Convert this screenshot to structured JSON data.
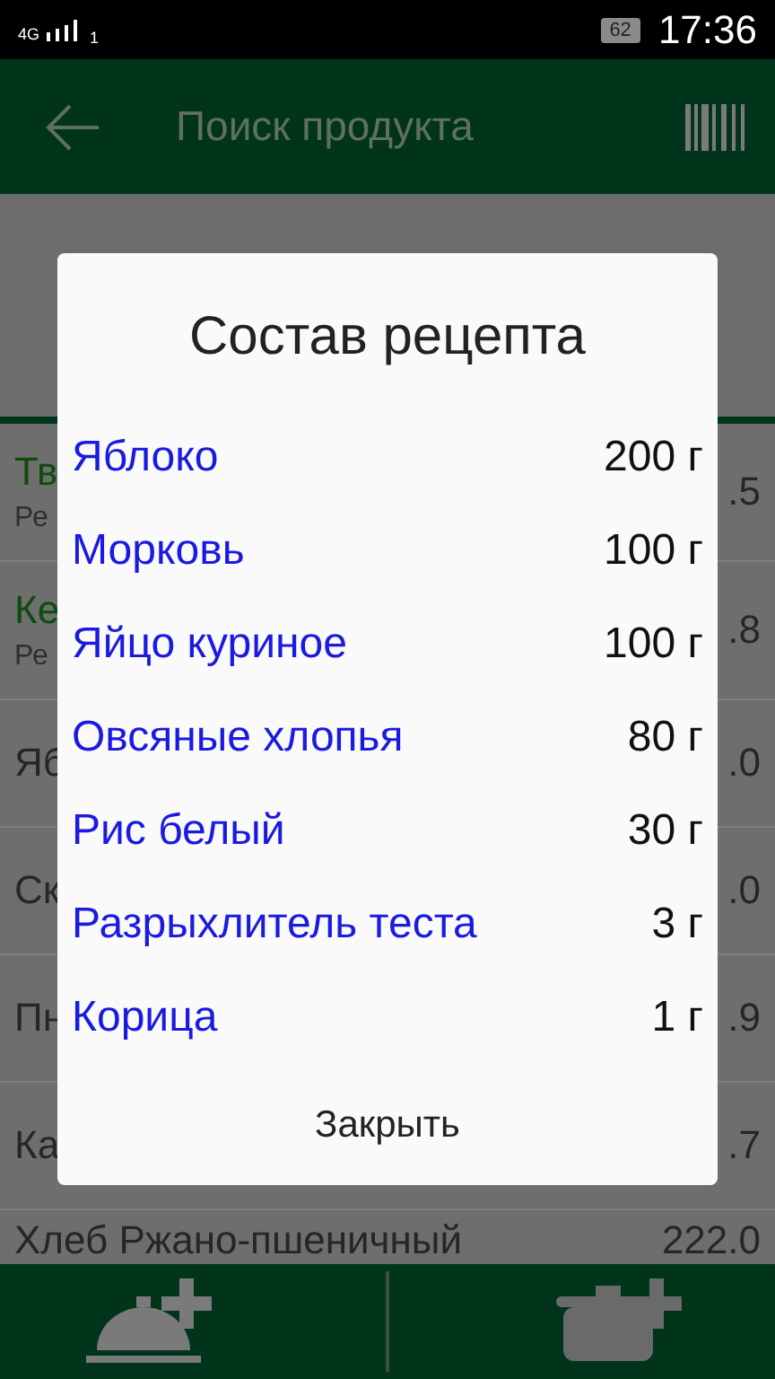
{
  "status_bar": {
    "network": "4G",
    "sim": "1",
    "battery": "62",
    "time": "17:36"
  },
  "app_bar": {
    "title": "Поиск продукта"
  },
  "list": [
    {
      "name": "Тв",
      "sub": "Ре",
      "value": ".5",
      "highlighted": true
    },
    {
      "name": "Ке",
      "sub": "Ре",
      "value": ".8",
      "highlighted": true
    },
    {
      "name": "Яб",
      "value": ".0",
      "highlighted": false
    },
    {
      "name": "Ск",
      "value": ".0",
      "highlighted": false
    },
    {
      "name": "Пн",
      "value": ".9",
      "highlighted": false
    },
    {
      "name": "Ка",
      "value": ".7",
      "highlighted": false
    },
    {
      "name": "Хлеб Ржано-пшеничный",
      "value": "222.0",
      "highlighted": false
    }
  ],
  "dialog": {
    "title": "Состав рецепта",
    "items": [
      {
        "name": "Яблоко",
        "amount": "200 г"
      },
      {
        "name": "Морковь",
        "amount": "100 г"
      },
      {
        "name": "Яйцо куриное",
        "amount": "100 г"
      },
      {
        "name": "Овсяные хлопья",
        "amount": "80 г"
      },
      {
        "name": "Рис белый",
        "amount": "30 г"
      },
      {
        "name": "Разрыхлитель теста",
        "amount": "3 г"
      },
      {
        "name": "Корица",
        "amount": "1 г"
      }
    ],
    "button": "Закрыть"
  }
}
